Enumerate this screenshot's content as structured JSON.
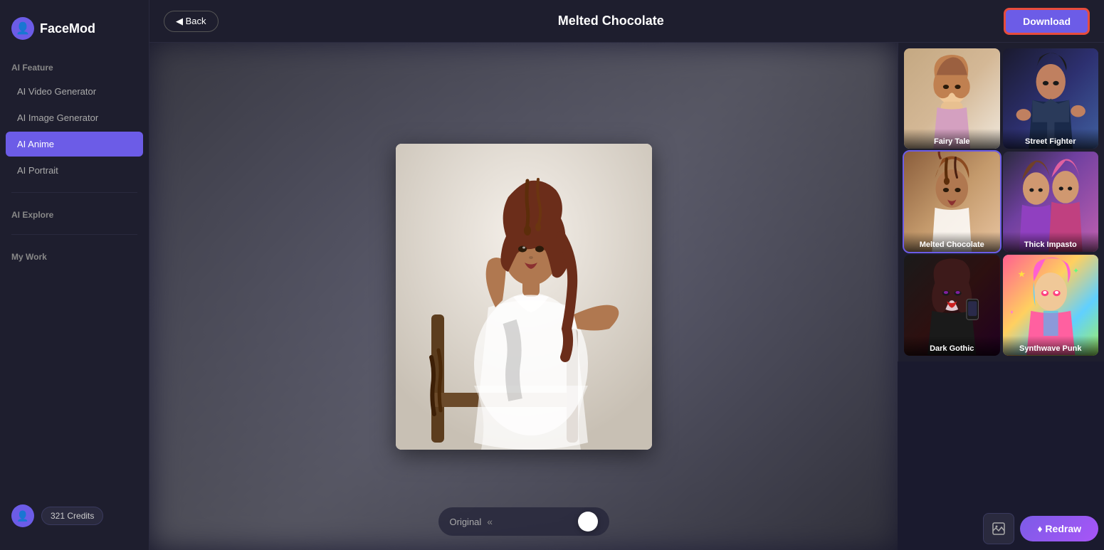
{
  "app": {
    "name": "FaceMod",
    "logo_emoji": "👤"
  },
  "sidebar": {
    "sections": [
      {
        "label": "AI Feature",
        "items": [
          {
            "id": "ai-video",
            "label": "AI Video Generator",
            "active": false
          },
          {
            "id": "ai-image",
            "label": "AI Image Generator",
            "active": false
          },
          {
            "id": "ai-anime",
            "label": "AI Anime",
            "active": true
          },
          {
            "id": "ai-portrait",
            "label": "AI Portrait",
            "active": false
          }
        ]
      },
      {
        "label": "AI Explore",
        "items": []
      },
      {
        "label": "My Work",
        "items": []
      }
    ],
    "credits": {
      "label": "321 Credits"
    }
  },
  "header": {
    "back_label": "◀ Back",
    "title": "Melted Chocolate",
    "download_label": "Download"
  },
  "styles": [
    {
      "id": "fairy-tale",
      "label": "Fairy Tale",
      "theme": "fairy-tale",
      "active": false
    },
    {
      "id": "street-fighter",
      "label": "Street Fighter",
      "theme": "street-fighter",
      "active": false
    },
    {
      "id": "melted-chocolate",
      "label": "Melted Chocolate",
      "theme": "melted-choco",
      "active": true
    },
    {
      "id": "thick-impasto",
      "label": "Thick Impasto",
      "theme": "thick-impasto",
      "active": false
    },
    {
      "id": "dark-gothic",
      "label": "Dark Gothic",
      "theme": "dark-gothic",
      "active": false
    },
    {
      "id": "synthwave-punk",
      "label": "Synthwave Punk",
      "theme": "synthwave-punk",
      "active": false
    }
  ],
  "slider": {
    "label": "Original",
    "arrows": "«"
  },
  "actions": {
    "redraw_label": "♦ Redraw"
  }
}
